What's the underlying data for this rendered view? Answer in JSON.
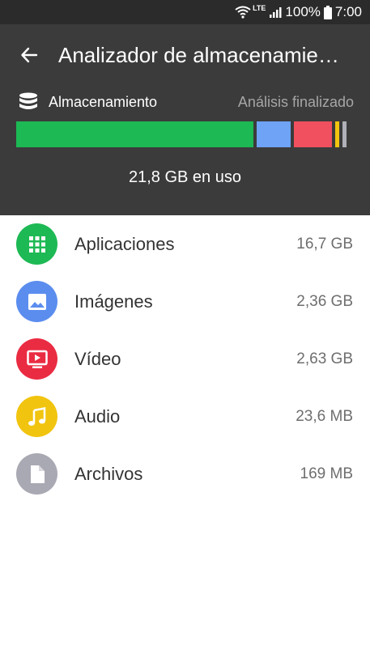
{
  "status_bar": {
    "network": "LTE",
    "battery": "100%",
    "time": "7:00"
  },
  "header": {
    "title": "Analizador de almacenamie…",
    "back_icon": "arrow-left-icon"
  },
  "storage": {
    "label": "Almacenamiento",
    "status": "Análisis finalizado",
    "icon": "database-icon",
    "usage_text": "21,8 GB en uso",
    "bar_segments": [
      {
        "category": "Aplicaciones",
        "fraction": 0.73,
        "color": "#1db954"
      },
      {
        "category": "Imágenes",
        "fraction": 0.105,
        "color": "#6ea3f5"
      },
      {
        "category": "Vídeo",
        "fraction": 0.118,
        "color": "#f1505f"
      },
      {
        "category": "Audio",
        "fraction": 0.012,
        "color": "#f1c40f"
      },
      {
        "category": "Archivos",
        "fraction": 0.012,
        "color": "#b0b0b8"
      }
    ]
  },
  "categories": [
    {
      "label": "Aplicaciones",
      "size": "16,7 GB",
      "color": "#1db954",
      "icon": "apps-grid-icon"
    },
    {
      "label": "Imágenes",
      "size": "2,36 GB",
      "color": "#5b8def",
      "icon": "image-icon"
    },
    {
      "label": "Vídeo",
      "size": "2,63 GB",
      "color": "#ea2c43",
      "icon": "video-icon"
    },
    {
      "label": "Audio",
      "size": "23,6 MB",
      "color": "#f1c40f",
      "icon": "music-note-icon"
    },
    {
      "label": "Archivos",
      "size": "169 MB",
      "color": "#a9a9b3",
      "icon": "file-icon"
    }
  ]
}
